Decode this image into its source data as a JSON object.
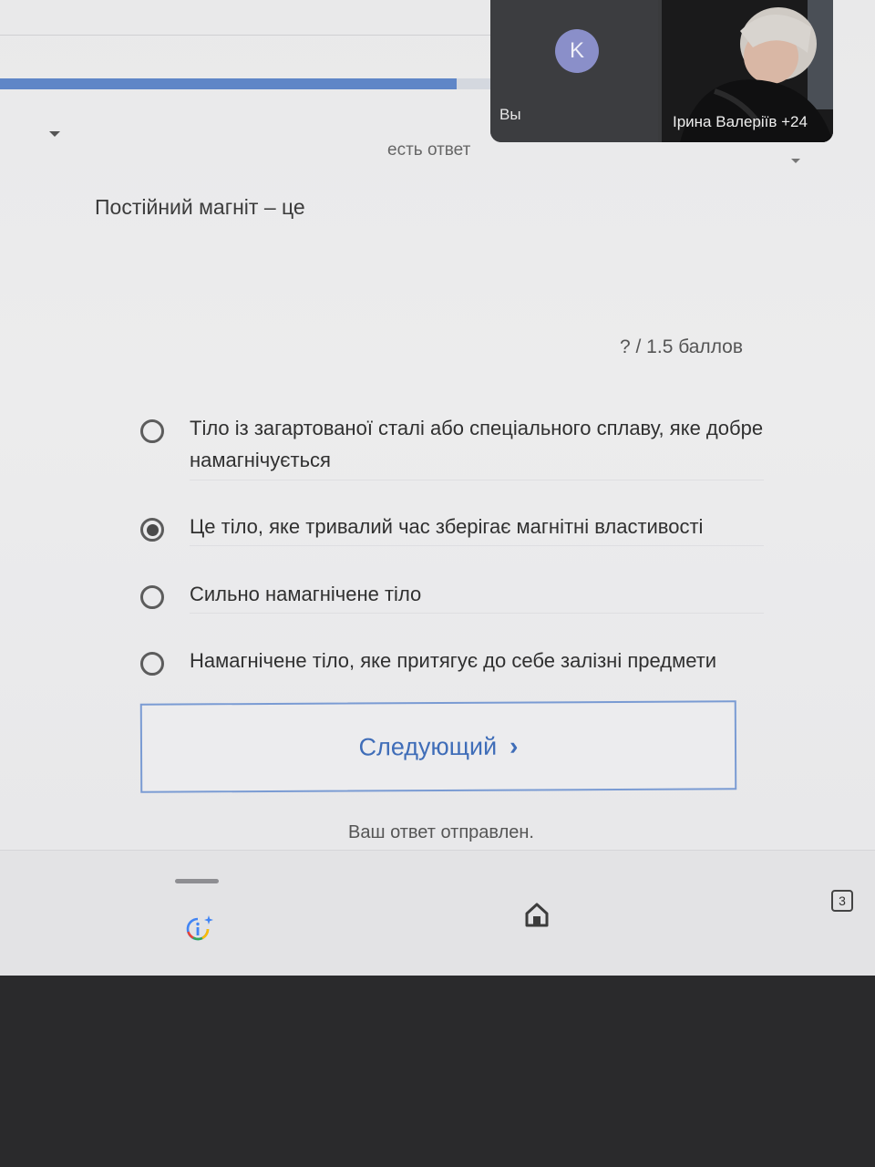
{
  "header": {
    "progress_fraction": 0.92,
    "accent_color": "#5f86c7"
  },
  "video_call": {
    "self_avatar_letter": "K",
    "self_label": "Вы",
    "participant_label": "Ірина Валеріїв +24"
  },
  "quiz": {
    "answer_hint": "есть ответ",
    "question": "Постійний магніт – це",
    "points": "? / 1.5 баллов",
    "options": [
      {
        "label": "Тіло із загартованої сталі або спеціального сплаву, яке добре намагнічується",
        "selected": false
      },
      {
        "label": "Це тіло, яке тривалий час зберігає магнітні властивості",
        "selected": true
      },
      {
        "label": "Сильно намагнічене тіло",
        "selected": false
      },
      {
        "label": "Намагнічене тіло, яке притягує до себе залізні предмети",
        "selected": false
      }
    ],
    "next_button": "Следующий",
    "submitted_message": "Ваш ответ отправлен."
  },
  "bottom_bar": {
    "icons": [
      "info-sparkle-icon",
      "home-icon",
      "tabs-icon"
    ],
    "tab_count": "3"
  }
}
